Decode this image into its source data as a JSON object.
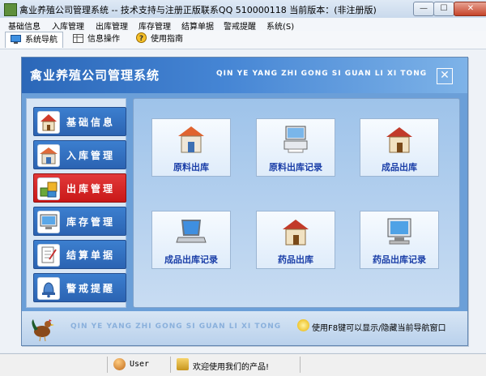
{
  "window": {
    "title": "禽业养殖公司管理系统 -- 技术支持与注册正版联系QQ 510000118    当前版本：(非注册版)",
    "controls": [
      "minimize",
      "maximize",
      "close"
    ]
  },
  "menu": [
    "基础信息",
    "入库管理",
    "出库管理",
    "库存管理",
    "结算单据",
    "警戒提醒",
    "系统(S)"
  ],
  "toolbar": {
    "nav_label": "系统导航",
    "info_label": "信息操作",
    "help_label": "使用指南"
  },
  "header": {
    "system_name": "禽业养殖公司管理系统",
    "pinyin": "QIN YE YANG ZHI GONG SI GUAN LI XI TONG",
    "close_glyph": "✕"
  },
  "nav": [
    {
      "label": "基础信息",
      "icon": "house-icon",
      "active": false
    },
    {
      "label": "入库管理",
      "icon": "warehouse-icon",
      "active": false
    },
    {
      "label": "出库管理",
      "icon": "boxes-icon",
      "active": true
    },
    {
      "label": "库存管理",
      "icon": "computer-icon",
      "active": false
    },
    {
      "label": "结算单据",
      "icon": "document-icon",
      "active": false
    },
    {
      "label": "警戒提醒",
      "icon": "bell-icon",
      "active": false
    }
  ],
  "tiles": [
    {
      "label": "原料出库",
      "icon": "warehouse-icon"
    },
    {
      "label": "原料出库记录",
      "icon": "printer-icon"
    },
    {
      "label": "成品出库",
      "icon": "house-icon"
    },
    {
      "label": "成品出库记录",
      "icon": "laptop-icon"
    },
    {
      "label": "药品出库",
      "icon": "house-icon"
    },
    {
      "label": "药品出库记录",
      "icon": "computer-icon"
    }
  ],
  "footer": {
    "pinyin": "QIN YE YANG ZHI GONG SI GUAN LI XI TONG",
    "tip": "使用F8键可以显示/隐藏当前导航窗口"
  },
  "status": {
    "user": "User",
    "welcome": "欢迎使用我们的产品!"
  },
  "colors": {
    "header_blue": "#2b67b8",
    "nav_blue": "#3c7fcf",
    "nav_active_red": "#d32525",
    "tile_label_blue": "#1b3fa8"
  }
}
